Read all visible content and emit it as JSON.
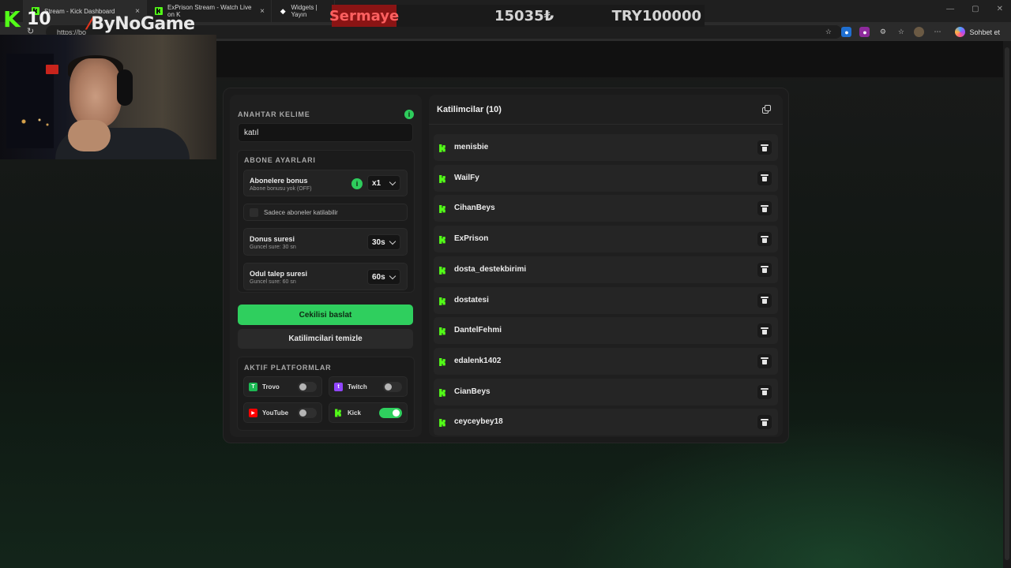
{
  "browser": {
    "tabs": [
      {
        "label": "Stream - Kick Dashboard"
      },
      {
        "label": "ExPrison Stream - Watch Live on K"
      },
      {
        "label": "Widgets | Yayın"
      }
    ],
    "url": "https://bo",
    "copilot_label": "Sohbet et"
  },
  "overlay": {
    "capital_label": "Sermaye",
    "capital_amount": "15035₺",
    "capital_goal": "TRY100000",
    "viewer_count": "10",
    "brand": "ByNoGame"
  },
  "settings": {
    "keyword_title": "ANAHTAR KELIME",
    "keyword_value": "katıl",
    "subscriber_title": "ABONE AYARLARI",
    "sub_bonus": {
      "title": "Abonelere bonus",
      "subtitle": "Abone bonusu yok (OFF)",
      "value": "x1"
    },
    "sub_only_label": "Sadece aboneler katilabilir",
    "bonus_duration": {
      "title": "Donus suresi",
      "subtitle": "Guncel sure: 30 sn",
      "value": "30s"
    },
    "claim_duration": {
      "title": "Odul talep suresi",
      "subtitle": "Guncel sure: 60 sn",
      "value": "60s"
    },
    "start_button": "Cekilisi baslat",
    "clear_button": "Katilimcilari temizle",
    "platforms_title": "AKTIF PLATFORMLAR",
    "platforms": [
      {
        "name": "Trovo",
        "enabled": false,
        "color": "#1db954"
      },
      {
        "name": "Twitch",
        "enabled": false,
        "color": "#9146ff"
      },
      {
        "name": "YouTube",
        "enabled": false,
        "color": "#ff0000"
      },
      {
        "name": "Kick",
        "enabled": true,
        "color": "#53fc18"
      }
    ]
  },
  "participants": {
    "title": "Katilimcilar (10)",
    "list": [
      "menisbie",
      "WailFy",
      "CihanBeys",
      "ExPrison",
      "dosta_destekbirimi",
      "dostatesi",
      "DantelFehmi",
      "edalenk1402",
      "CianBeys",
      "ceyceybey18"
    ]
  },
  "colors": {
    "accent": "#2fcf5e",
    "kick_green": "#53fc18",
    "panel": "#1f1f1f"
  }
}
